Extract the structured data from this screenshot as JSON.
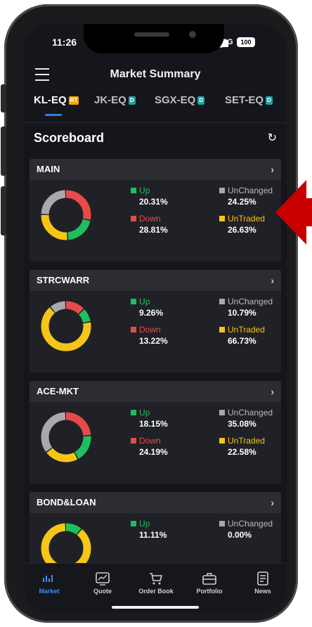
{
  "status": {
    "time": "11:26",
    "network": "5G",
    "battery": "100"
  },
  "header": {
    "title": "Market Summary"
  },
  "tabs": [
    {
      "label": "KL-EQ",
      "badge": "RT",
      "badge_color": "#f0a800",
      "active": true
    },
    {
      "label": "JK-EQ",
      "badge": "D",
      "badge_color": "#1aa3a3",
      "active": false
    },
    {
      "label": "SGX-EQ",
      "badge": "D",
      "badge_color": "#1aa3a3",
      "active": false
    },
    {
      "label": "SET-EQ",
      "badge": "D",
      "badge_color": "#1aa3a3",
      "active": false
    }
  ],
  "scoreboard": {
    "title": "Scoreboard"
  },
  "legend_labels": {
    "up": "Up",
    "down": "Down",
    "unchanged": "UnChanged",
    "untraded": "UnTraded"
  },
  "colors": {
    "up": "#1fbf5f",
    "down": "#e84a4a",
    "unchanged": "#a8a9ae",
    "untraded": "#f5c518",
    "accent": "#2f7de1",
    "arrow": "#c80000"
  },
  "boards": [
    {
      "name": "MAIN",
      "up": "20.31%",
      "down": "28.81%",
      "unchanged": "24.25%",
      "untraded": "26.63%",
      "values": {
        "up": 20.31,
        "down": 28.81,
        "unchanged": 24.25,
        "untraded": 26.63
      }
    },
    {
      "name": "STRCWARR",
      "up": "9.26%",
      "down": "13.22%",
      "unchanged": "10.79%",
      "untraded": "66.73%",
      "values": {
        "up": 9.26,
        "down": 13.22,
        "unchanged": 10.79,
        "untraded": 66.73
      }
    },
    {
      "name": "ACE-MKT",
      "up": "18.15%",
      "down": "24.19%",
      "unchanged": "35.08%",
      "untraded": "22.58%",
      "values": {
        "up": 18.15,
        "down": 24.19,
        "unchanged": 35.08,
        "untraded": 22.58
      }
    },
    {
      "name": "BOND&LOAN",
      "up": "11.11%",
      "down": "",
      "unchanged": "0.00%",
      "untraded": "",
      "values": {
        "up": 11.11,
        "down": 0,
        "unchanged": 0,
        "untraded": 88.89
      }
    }
  ],
  "nav": [
    {
      "label": "Market",
      "icon": "market-icon",
      "active": true
    },
    {
      "label": "Quote",
      "icon": "quote-icon",
      "active": false
    },
    {
      "label": "Order Book",
      "icon": "cart-icon",
      "active": false
    },
    {
      "label": "Portfolio",
      "icon": "briefcase-icon",
      "active": false
    },
    {
      "label": "News",
      "icon": "news-icon",
      "active": false
    }
  ]
}
